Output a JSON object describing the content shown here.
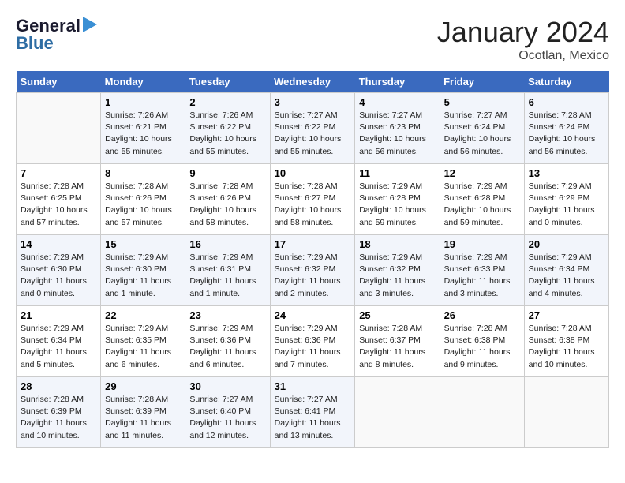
{
  "header": {
    "logo_general": "General",
    "logo_blue": "Blue",
    "month_title": "January 2024",
    "location": "Ocotlan, Mexico"
  },
  "days_of_week": [
    "Sunday",
    "Monday",
    "Tuesday",
    "Wednesday",
    "Thursday",
    "Friday",
    "Saturday"
  ],
  "weeks": [
    [
      {
        "day": "",
        "info": ""
      },
      {
        "day": "1",
        "info": "Sunrise: 7:26 AM\nSunset: 6:21 PM\nDaylight: 10 hours\nand 55 minutes."
      },
      {
        "day": "2",
        "info": "Sunrise: 7:26 AM\nSunset: 6:22 PM\nDaylight: 10 hours\nand 55 minutes."
      },
      {
        "day": "3",
        "info": "Sunrise: 7:27 AM\nSunset: 6:22 PM\nDaylight: 10 hours\nand 55 minutes."
      },
      {
        "day": "4",
        "info": "Sunrise: 7:27 AM\nSunset: 6:23 PM\nDaylight: 10 hours\nand 56 minutes."
      },
      {
        "day": "5",
        "info": "Sunrise: 7:27 AM\nSunset: 6:24 PM\nDaylight: 10 hours\nand 56 minutes."
      },
      {
        "day": "6",
        "info": "Sunrise: 7:28 AM\nSunset: 6:24 PM\nDaylight: 10 hours\nand 56 minutes."
      }
    ],
    [
      {
        "day": "7",
        "info": "Sunrise: 7:28 AM\nSunset: 6:25 PM\nDaylight: 10 hours\nand 57 minutes."
      },
      {
        "day": "8",
        "info": "Sunrise: 7:28 AM\nSunset: 6:26 PM\nDaylight: 10 hours\nand 57 minutes."
      },
      {
        "day": "9",
        "info": "Sunrise: 7:28 AM\nSunset: 6:26 PM\nDaylight: 10 hours\nand 58 minutes."
      },
      {
        "day": "10",
        "info": "Sunrise: 7:28 AM\nSunset: 6:27 PM\nDaylight: 10 hours\nand 58 minutes."
      },
      {
        "day": "11",
        "info": "Sunrise: 7:29 AM\nSunset: 6:28 PM\nDaylight: 10 hours\nand 59 minutes."
      },
      {
        "day": "12",
        "info": "Sunrise: 7:29 AM\nSunset: 6:28 PM\nDaylight: 10 hours\nand 59 minutes."
      },
      {
        "day": "13",
        "info": "Sunrise: 7:29 AM\nSunset: 6:29 PM\nDaylight: 11 hours\nand 0 minutes."
      }
    ],
    [
      {
        "day": "14",
        "info": "Sunrise: 7:29 AM\nSunset: 6:30 PM\nDaylight: 11 hours\nand 0 minutes."
      },
      {
        "day": "15",
        "info": "Sunrise: 7:29 AM\nSunset: 6:30 PM\nDaylight: 11 hours\nand 1 minute."
      },
      {
        "day": "16",
        "info": "Sunrise: 7:29 AM\nSunset: 6:31 PM\nDaylight: 11 hours\nand 1 minute."
      },
      {
        "day": "17",
        "info": "Sunrise: 7:29 AM\nSunset: 6:32 PM\nDaylight: 11 hours\nand 2 minutes."
      },
      {
        "day": "18",
        "info": "Sunrise: 7:29 AM\nSunset: 6:32 PM\nDaylight: 11 hours\nand 3 minutes."
      },
      {
        "day": "19",
        "info": "Sunrise: 7:29 AM\nSunset: 6:33 PM\nDaylight: 11 hours\nand 3 minutes."
      },
      {
        "day": "20",
        "info": "Sunrise: 7:29 AM\nSunset: 6:34 PM\nDaylight: 11 hours\nand 4 minutes."
      }
    ],
    [
      {
        "day": "21",
        "info": "Sunrise: 7:29 AM\nSunset: 6:34 PM\nDaylight: 11 hours\nand 5 minutes."
      },
      {
        "day": "22",
        "info": "Sunrise: 7:29 AM\nSunset: 6:35 PM\nDaylight: 11 hours\nand 6 minutes."
      },
      {
        "day": "23",
        "info": "Sunrise: 7:29 AM\nSunset: 6:36 PM\nDaylight: 11 hours\nand 6 minutes."
      },
      {
        "day": "24",
        "info": "Sunrise: 7:29 AM\nSunset: 6:36 PM\nDaylight: 11 hours\nand 7 minutes."
      },
      {
        "day": "25",
        "info": "Sunrise: 7:28 AM\nSunset: 6:37 PM\nDaylight: 11 hours\nand 8 minutes."
      },
      {
        "day": "26",
        "info": "Sunrise: 7:28 AM\nSunset: 6:38 PM\nDaylight: 11 hours\nand 9 minutes."
      },
      {
        "day": "27",
        "info": "Sunrise: 7:28 AM\nSunset: 6:38 PM\nDaylight: 11 hours\nand 10 minutes."
      }
    ],
    [
      {
        "day": "28",
        "info": "Sunrise: 7:28 AM\nSunset: 6:39 PM\nDaylight: 11 hours\nand 10 minutes."
      },
      {
        "day": "29",
        "info": "Sunrise: 7:28 AM\nSunset: 6:39 PM\nDaylight: 11 hours\nand 11 minutes."
      },
      {
        "day": "30",
        "info": "Sunrise: 7:27 AM\nSunset: 6:40 PM\nDaylight: 11 hours\nand 12 minutes."
      },
      {
        "day": "31",
        "info": "Sunrise: 7:27 AM\nSunset: 6:41 PM\nDaylight: 11 hours\nand 13 minutes."
      },
      {
        "day": "",
        "info": ""
      },
      {
        "day": "",
        "info": ""
      },
      {
        "day": "",
        "info": ""
      }
    ]
  ]
}
